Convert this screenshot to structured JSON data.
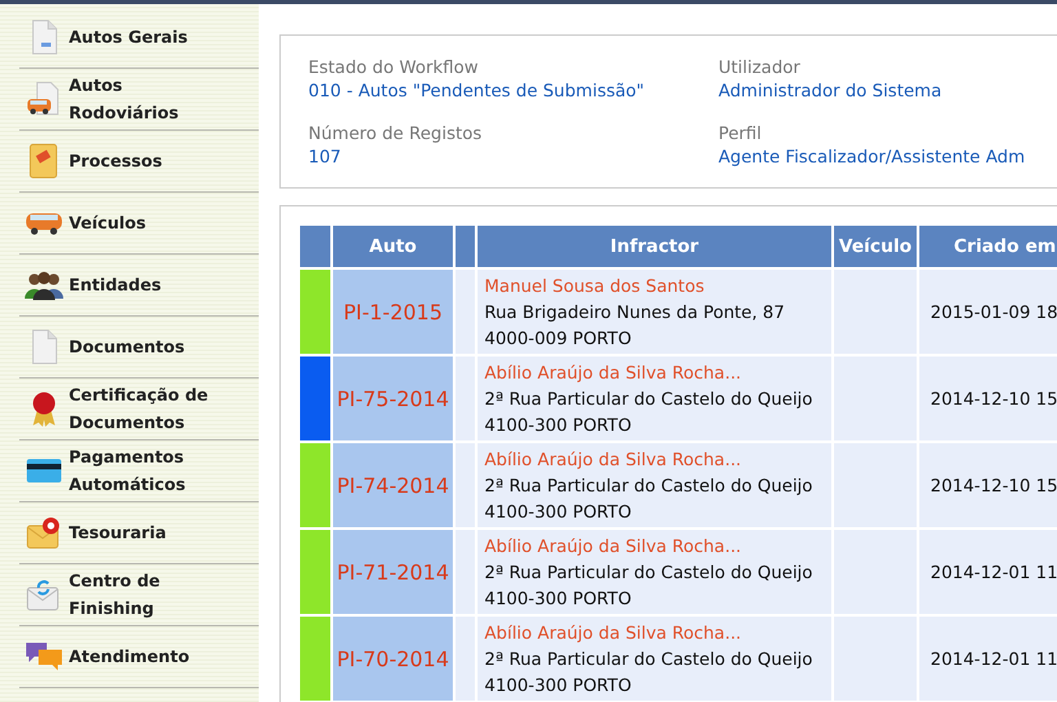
{
  "sidebar": {
    "items": [
      {
        "label": "Autos Gerais"
      },
      {
        "label": "Autos Rodoviários"
      },
      {
        "label": "Processos"
      },
      {
        "label": "Veículos"
      },
      {
        "label": "Entidades"
      },
      {
        "label": "Documentos"
      },
      {
        "label": "Certificação de Documentos"
      },
      {
        "label": "Pagamentos Automáticos"
      },
      {
        "label": "Tesouraria"
      },
      {
        "label": "Centro de Finishing"
      },
      {
        "label": "Atendimento"
      }
    ]
  },
  "info": [
    {
      "label": "Estado do Workflow",
      "value": "010 - Autos \"Pendentes de Submissão\""
    },
    {
      "label": "Utilizador",
      "value": "Administrador do Sistema"
    },
    {
      "label": "Número de Registos",
      "value": "107"
    },
    {
      "label": "Perfil",
      "value": "Agente Fiscalizador/Assistente Adm"
    }
  ],
  "table": {
    "columns": [
      "Auto",
      "Infractor",
      "Veículo",
      "Criado em"
    ],
    "rows": [
      {
        "color": "#8ee62a",
        "auto": "PI-1-2015",
        "name": "Manuel Sousa dos Santos",
        "address": "Rua Brigadeiro Nunes da Ponte, 87",
        "city": "4000-009 PORTO",
        "vehicle": "",
        "created": "2015-01-09 18"
      },
      {
        "color": "#0a5cf0",
        "auto": "PI-75-2014",
        "name": "Abílio Araújo da Silva Rocha...",
        "address": "2ª Rua Particular do Castelo do Queijo",
        "city": "4100-300 PORTO",
        "vehicle": "",
        "created": "2014-12-10 15"
      },
      {
        "color": "#8ee62a",
        "auto": "PI-74-2014",
        "name": "Abílio Araújo da Silva Rocha...",
        "address": "2ª Rua Particular do Castelo do Queijo",
        "city": "4100-300 PORTO",
        "vehicle": "",
        "created": "2014-12-10 15"
      },
      {
        "color": "#8ee62a",
        "auto": "PI-71-2014",
        "name": "Abílio Araújo da Silva Rocha...",
        "address": "2ª Rua Particular do Castelo do Queijo",
        "city": "4100-300 PORTO",
        "vehicle": "",
        "created": "2014-12-01 11"
      },
      {
        "color": "#8ee62a",
        "auto": "PI-70-2014",
        "name": "Abílio Araújo da Silva Rocha...",
        "address": "2ª Rua Particular do Castelo do Queijo",
        "city": "4100-300 PORTO",
        "vehicle": "",
        "created": "2014-12-01 11"
      }
    ]
  }
}
